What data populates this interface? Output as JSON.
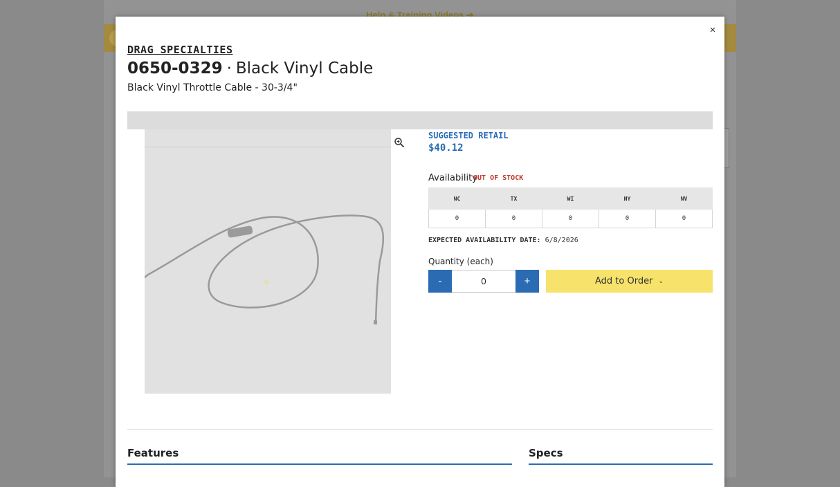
{
  "background": {
    "help_link": "Help & Training Videos",
    "help_arrow": "➔"
  },
  "modal": {
    "close_label": "×",
    "brand": "DRAG SPECIALTIES",
    "sku": "0650-0329",
    "separator": "·",
    "name": "Black Vinyl Cable",
    "subtitle": "Black Vinyl Throttle Cable - 30-3/4\"",
    "suggested_retail_label": "SUGGESTED RETAIL",
    "suggested_retail_price": "$40.12",
    "availability_label": "Availability",
    "stock_status": "OUT OF STOCK",
    "warehouses": {
      "headers": [
        "NC",
        "TX",
        "WI",
        "NY",
        "NV"
      ],
      "values": [
        "0",
        "0",
        "0",
        "0",
        "0"
      ]
    },
    "expected_label": "EXPECTED AVAILABILITY DATE:",
    "expected_date": "6/8/2026",
    "quantity_label": "Quantity (each)",
    "qty_minus": "-",
    "qty_plus": "+",
    "qty_value": "0",
    "add_to_order": "Add to Order",
    "add_chevron": "⌄",
    "features_heading": "Features",
    "specs_heading": "Specs"
  },
  "colors": {
    "accent_blue": "#2a6bb4",
    "add_button_yellow": "#f7e26b",
    "out_of_stock_red": "#c0392b",
    "overlay_gray": "#8a8a8a"
  },
  "icons": {
    "close": "close-icon",
    "zoom": "zoom-in-icon",
    "chevron": "chevron-down-icon",
    "help_arrow": "arrow-right-icon"
  }
}
